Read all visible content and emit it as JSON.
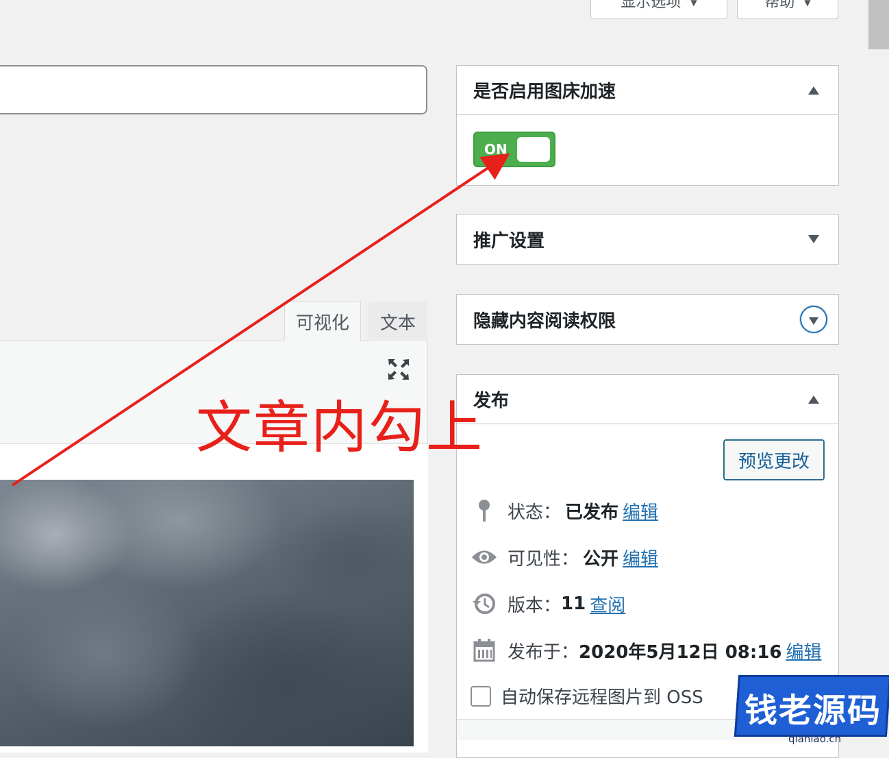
{
  "top_buttons": {
    "screen_options_label": "显示选项",
    "help_label": "帮助"
  },
  "editor": {
    "tab_visual": "可视化",
    "tab_text": "文本"
  },
  "boxes": {
    "image_acceleration": {
      "title": "是否启用图床加速",
      "switch_label": "ON"
    },
    "promotion": {
      "title": "推广设置"
    },
    "hidden_content": {
      "title": "隐藏内容阅读权限"
    },
    "publish": {
      "title": "发布",
      "preview_button": "预览更改",
      "status_label": "状态：",
      "status_value": "已发布",
      "status_edit": "编辑",
      "visibility_label": "可见性：",
      "visibility_value": "公开",
      "visibility_edit": "编辑",
      "revisions_label": "版本：",
      "revisions_value": "11",
      "revisions_browse": "查阅",
      "published_label": "发布于：",
      "published_value": "2020年5月12日 08:16",
      "published_edit": "编辑",
      "auto_save_label": "自动保存远程图片到 OSS"
    }
  },
  "annotation": {
    "text": "文章内勾上",
    "color": "#e8201a"
  },
  "watermark": {
    "text": "钱老源码",
    "domain": "qianlao.cn",
    "color": "#1f5fd6"
  },
  "colors": {
    "switch_on": "#4cae4c",
    "link": "#2271b1"
  }
}
